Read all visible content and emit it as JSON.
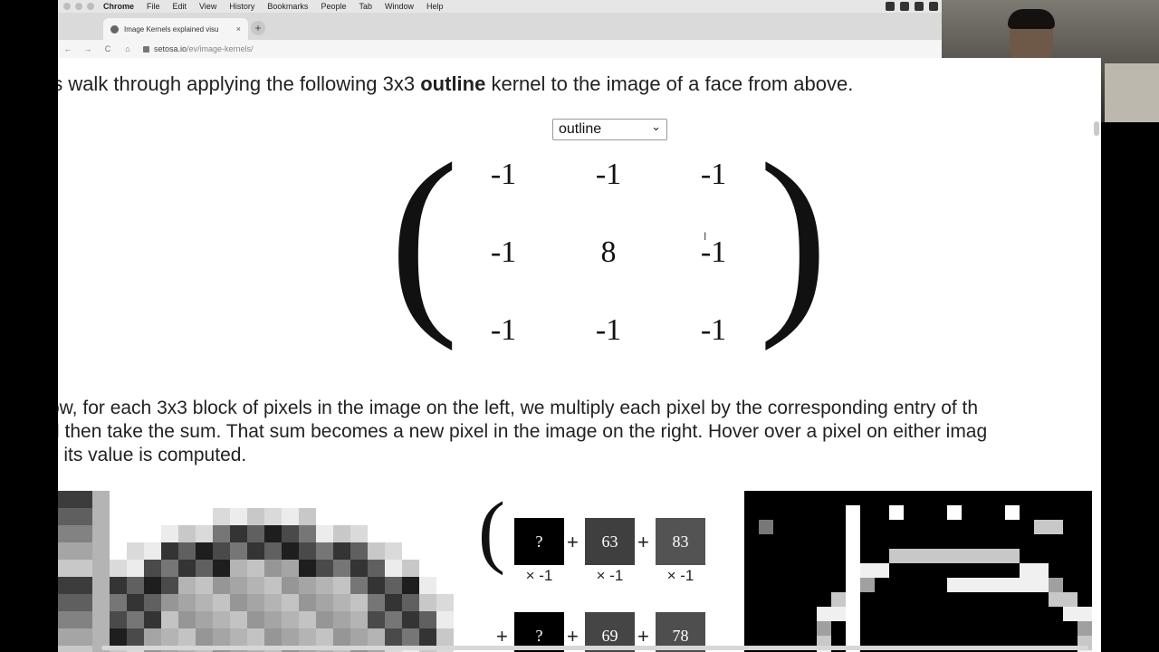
{
  "menubar": {
    "items": [
      "Chrome",
      "File",
      "Edit",
      "View",
      "History",
      "Bookmarks",
      "People",
      "Tab",
      "Window",
      "Help"
    ]
  },
  "browser": {
    "tab_title": "Image Kernels explained visu",
    "tab_close": "×",
    "new_tab": "+",
    "url_host": "setosa.io",
    "url_path": "/ev/image-kernels/",
    "back": "←",
    "forward": "→",
    "reload": "C",
    "home": "⌂"
  },
  "page": {
    "intro_prefix": "'s walk through applying the following 3x3 ",
    "intro_bold": "outline",
    "intro_suffix": " kernel to the image of a face from above.",
    "kernel_select": {
      "value": "outline",
      "caret": "⌄"
    },
    "paren_left": "(",
    "paren_right": ")",
    "matrix": [
      [
        "-1",
        "-1",
        "-1"
      ],
      [
        "-1",
        "8",
        "-1"
      ],
      [
        "-1",
        "-1",
        "-1"
      ]
    ],
    "explain_lines": [
      "ow, for each 3x3 block of pixels in the image on the left, we multiply each pixel by the corresponding entry of th",
      "d then take the sum. That sum becomes a new pixel in the image on the right. Hover over a pixel on either imag",
      "v its value is computed."
    ],
    "calculation": {
      "paren": "(",
      "row1": [
        {
          "value": "?",
          "multiplier": "× -1",
          "color": "#000000"
        },
        {
          "value": "63",
          "multiplier": "× -1",
          "color": "#3f3f3f"
        },
        {
          "value": "83",
          "multiplier": "× -1",
          "color": "#535353"
        }
      ],
      "row2": [
        {
          "value": "?",
          "color": "#000000"
        },
        {
          "value": "69",
          "color": "#454545"
        },
        {
          "value": "78",
          "color": "#4e4e4e"
        }
      ],
      "plus": "+"
    }
  }
}
